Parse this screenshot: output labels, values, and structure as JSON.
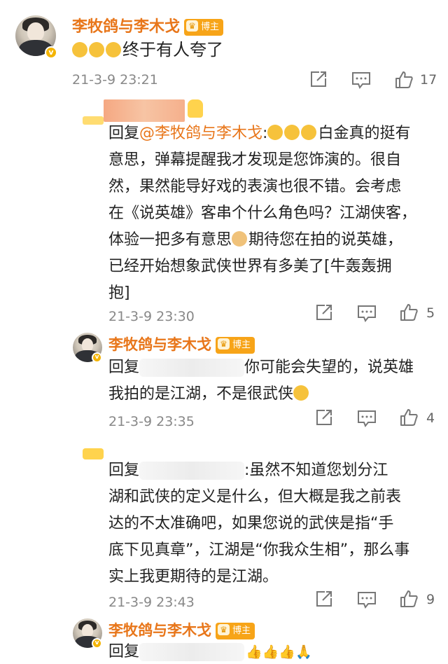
{
  "c1": {
    "name": "李牧鸽与李木戈",
    "badge": "博主",
    "emoji_text": "😭😭😭",
    "text": "终于有人夸了",
    "time": "21-3-9 23:21",
    "likes": "17"
  },
  "c2": {
    "reply_prefix": "回复",
    "mention": "@李牧鸽与李木戈",
    "colon": ":",
    "emoji": "😂😂😂",
    "lines": [
      "白金真的挺有",
      "意思，弹幕提醒我才发现是您饰演的。很自",
      "然，果然能导好戏的表演也很不错。会考虑",
      "在《说英雄》客串个什么角色吗？江湖侠客，",
      "体验一把多有意思",
      "期待您在拍的说英雄，",
      "已经开始想象武侠世界有多美了[牛轰轰拥",
      "抱]"
    ],
    "time": "21-3-9 23:30",
    "likes": "5"
  },
  "c3": {
    "name": "李牧鸽与李木戈",
    "badge": "博主",
    "reply_prefix": "回复",
    "line1": "你可能会失望的，说英雄",
    "line2": "我拍的是江湖，不是很武侠",
    "time": "21-3-9 23:35",
    "likes": "4"
  },
  "c4": {
    "reply_prefix": "回复",
    "lines": [
      ":虽然不知道您划分江",
      "湖和武侠的定义是什么，但大概是我之前表",
      "达的不太准确吧，如果您说的武侠是指“手",
      "底下见真章”，江湖是“你我众生相”，那么事",
      "实上我更期待的是江湖。"
    ],
    "time": "21-3-9 23:43",
    "likes": "9"
  },
  "c5": {
    "name": "李牧鸽与李木戈",
    "badge": "博主",
    "reply_prefix": "回复",
    "emoji": "👍👍👍🙏"
  },
  "icons": {
    "share": "share-icon",
    "comment": "comment-icon",
    "like": "thumbs-up-icon"
  }
}
